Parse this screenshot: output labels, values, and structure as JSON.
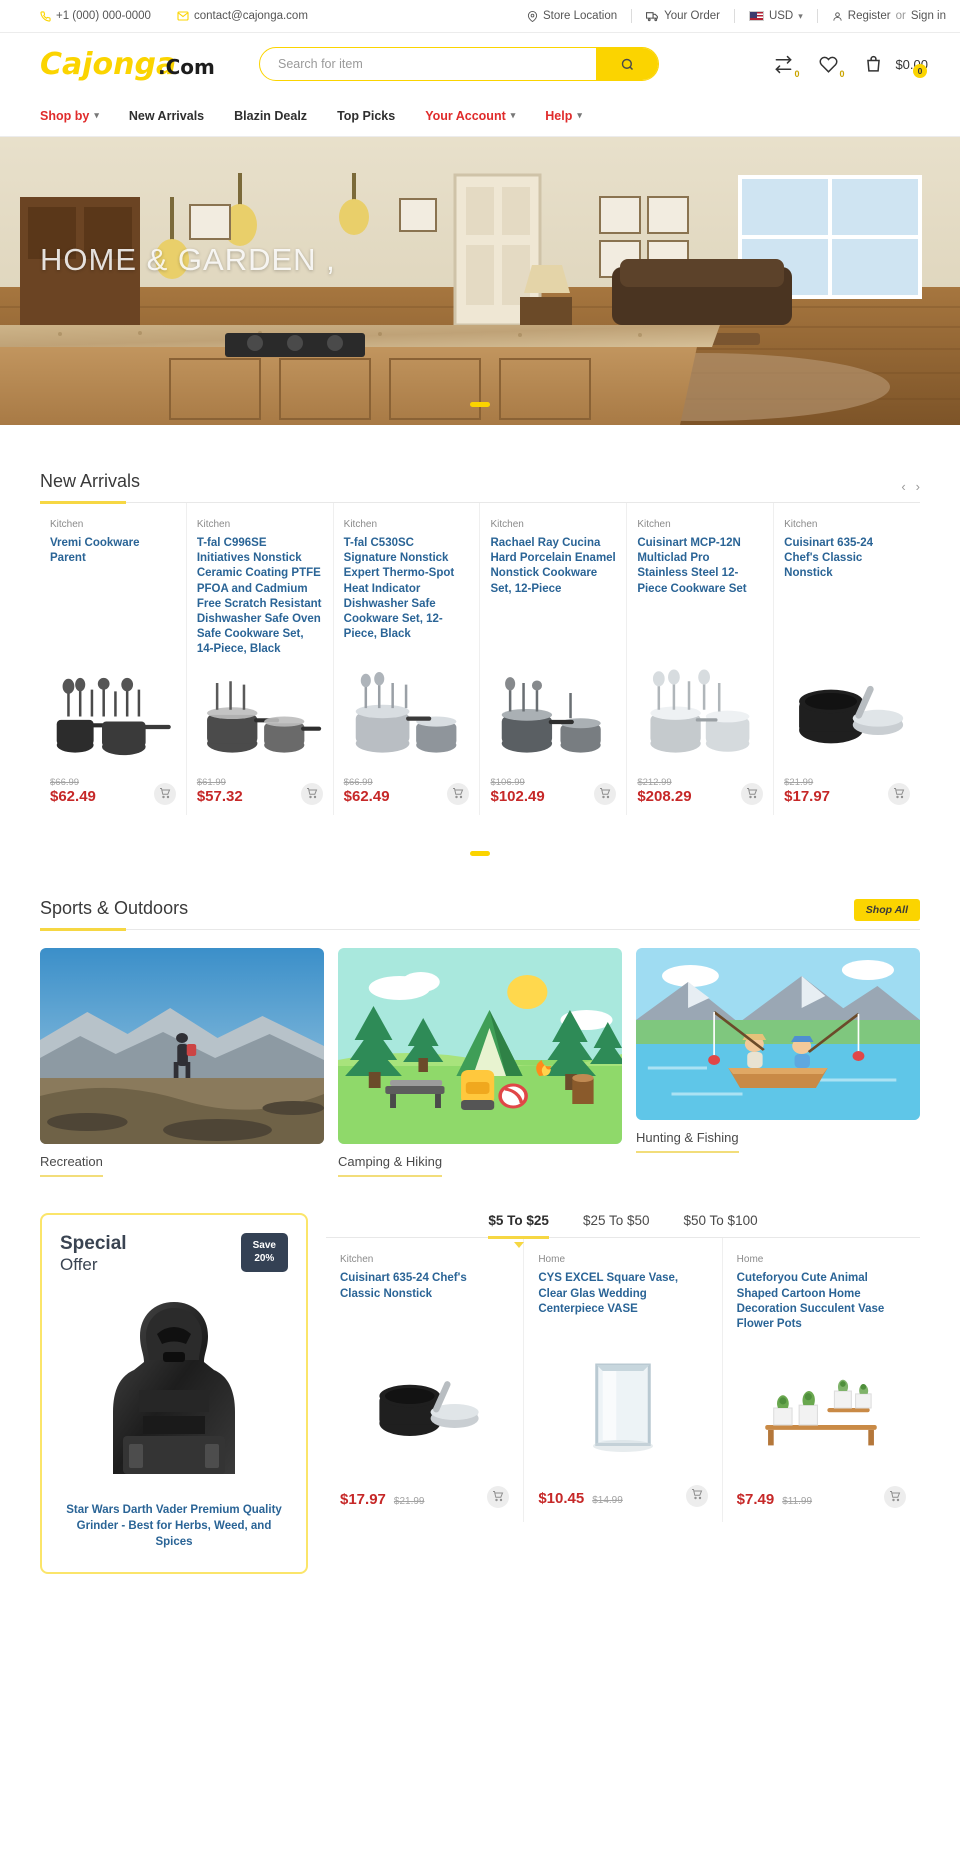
{
  "topbar": {
    "phone": "+1 (000) 000-0000",
    "email": "contact@cajonga.com",
    "store_location": "Store Location",
    "your_order": "Your Order",
    "currency": "USD",
    "register": "Register",
    "or": " or ",
    "signin": "Sign in"
  },
  "header": {
    "logo_text": "Cajonga",
    "logo_suffix": ".Com",
    "search_placeholder": "Search for item",
    "search_value": "",
    "compare_count": "0",
    "wishlist_count": "0",
    "cart_count": "0",
    "cart_total": "$0.00"
  },
  "nav": {
    "items": [
      {
        "label": "Shop by",
        "accent": true,
        "caret": true
      },
      {
        "label": "New Arrivals",
        "accent": false,
        "caret": false
      },
      {
        "label": "Blazin Dealz",
        "accent": false,
        "caret": false
      },
      {
        "label": "Top Picks",
        "accent": false,
        "caret": false
      },
      {
        "label": "Your Account",
        "accent": true,
        "caret": true
      },
      {
        "label": "Help",
        "accent": true,
        "caret": true
      }
    ]
  },
  "hero": {
    "title": "HOME & GARDEN ,"
  },
  "new_arrivals": {
    "title": "New Arrivals",
    "prev": "‹",
    "next": "›",
    "products": [
      {
        "category": "Kitchen",
        "name": "Vremi Cookware Parent",
        "old_price": "$66.99",
        "price": "$62.49",
        "image": "cookware-set-black"
      },
      {
        "category": "Kitchen",
        "name": "T-fal C996SE Initiatives Nonstick Ceramic Coating PTFE PFOA and Cadmium Free Scratch Resistant Dishwasher Safe Oven Safe Cookware Set, 14-Piece, Black",
        "old_price": "$61.99",
        "price": "$57.32",
        "image": "cookware-set-grey"
      },
      {
        "category": "Kitchen",
        "name": "T-fal C530SC Signature Nonstick Expert Thermo-Spot Heat Indicator Dishwasher Safe Cookware Set, 12-Piece, Black",
        "old_price": "$66.99",
        "price": "$62.49",
        "image": "cookware-set-steel"
      },
      {
        "category": "Kitchen",
        "name": "Rachael Ray Cucina Hard Porcelain Enamel Nonstick Cookware Set, 12-Piece",
        "old_price": "$106.99",
        "price": "$102.49",
        "image": "cookware-set-enamel"
      },
      {
        "category": "Kitchen",
        "name": "Cuisinart MCP-12N Multiclad Pro Stainless Steel 12-Piece Cookware Set",
        "old_price": "$212.99",
        "price": "$208.29",
        "image": "cookware-set-stainless"
      },
      {
        "category": "Kitchen",
        "name": "Cuisinart 635-24 Chef's Classic Nonstick",
        "old_price": "$21.99",
        "price": "$17.97",
        "image": "saucepan-black"
      }
    ]
  },
  "sports": {
    "title": "Sports & Outdoors",
    "shop_all": "Shop All",
    "categories": [
      {
        "label": "Recreation",
        "image": "hiker-mountain-photo"
      },
      {
        "label": "Camping & Hiking",
        "image": "camping-illustration"
      },
      {
        "label": "Hunting & Fishing",
        "image": "fishing-illustration"
      }
    ]
  },
  "special_offer": {
    "title_line1": "Special",
    "title_line2": "Offer",
    "save_line1": "Save",
    "save_line2": "20%",
    "product_name": "Star Wars Darth Vader Premium Quality Grinder - Best for Herbs, Weed, and Spices",
    "image": "darth-vader-grinder"
  },
  "price_tabs": {
    "tabs": [
      {
        "label": "$5 To $25",
        "active": true
      },
      {
        "label": "$25 To $50",
        "active": false
      },
      {
        "label": "$50 To $100",
        "active": false
      }
    ],
    "products": [
      {
        "category": "Kitchen",
        "name": "Cuisinart 635-24 Chef's Classic Nonstick",
        "price": "$17.97",
        "old_price": "$21.99",
        "image": "saucepan-black"
      },
      {
        "category": "Home",
        "name": "CYS EXCEL Square Vase, Clear Glas Wedding Centerpiece VASE",
        "price": "$10.45",
        "old_price": "$14.99",
        "image": "glass-vase"
      },
      {
        "category": "Home",
        "name": "Cuteforyou Cute Animal Shaped Cartoon Home Decoration Succulent Vase Flower Pots",
        "price": "$7.49",
        "old_price": "$11.99",
        "image": "succulent-pots"
      }
    ]
  },
  "colors": {
    "accent_yellow": "#fbd400",
    "accent_red": "#e02b2b",
    "price_red": "#c62828",
    "link_blue": "#2a6496",
    "dark_navy": "#344154"
  }
}
